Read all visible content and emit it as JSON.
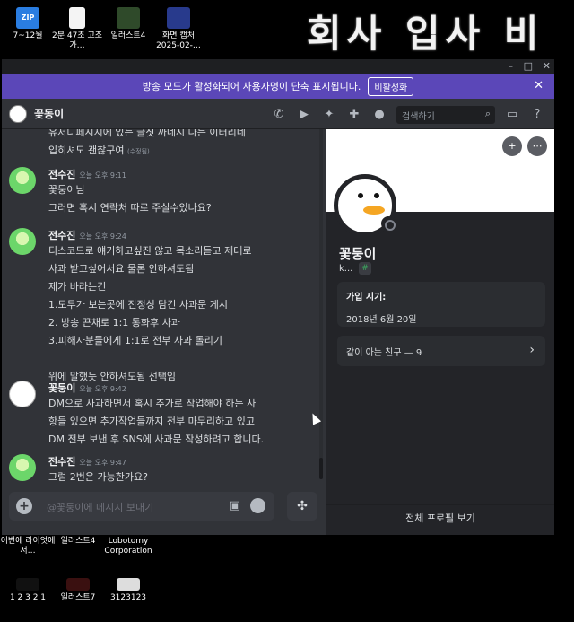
{
  "desktop": {
    "overlay_title": "회사 입사 비",
    "top_icons": [
      {
        "label": "7~12월",
        "icon": "zip-archive-icon"
      },
      {
        "label": "2분 47초 고조가…",
        "icon": "document-icon"
      },
      {
        "label": "일러스트4",
        "icon": "image-file-icon"
      },
      {
        "label": "화면 캡처 2025-02-…",
        "icon": "screenshot-icon"
      }
    ],
    "bottom_icons": [
      {
        "label": "이번에 라이엇에서…",
        "icon": "file-icon"
      },
      {
        "label": "일러스트4",
        "icon": "file-icon"
      },
      {
        "label": "Lobotomy Corporation",
        "icon": "game-icon"
      },
      {
        "label": "1 2 3 2 1",
        "icon": "image-file-icon"
      },
      {
        "label": "일러스트7",
        "icon": "image-file-icon"
      },
      {
        "label": "3123123",
        "icon": "image-file-icon"
      }
    ]
  },
  "window": {
    "controls": [
      "–",
      "□",
      "✕"
    ],
    "banner": {
      "text": "방송 모드가 활성화되어 사용자명이 단축 표시됩니다.",
      "button": "비활성화",
      "close": "✕"
    },
    "header": {
      "name": "꽃동이",
      "search_placeholder": "검색하기"
    }
  },
  "chat": {
    "partial_lines": [
      "유저디페시지에 있는 글짓 까네시 나는 이터리네",
      "입히셔도 괜찮구여"
    ],
    "partial_edited": "(수정됨)",
    "messages": [
      {
        "author": "전수진",
        "time": "오늘 오후 9:11",
        "avatar": "green",
        "lines": [
          "꽃둥이님",
          "그러면 혹시 연락처 따로 주실수있나요?"
        ]
      },
      {
        "author": "전수진",
        "time": "오늘 오후 9:24",
        "avatar": "green",
        "lines": [
          "디스코드로 얘기하고싶진 않고 목소리듣고 제대로",
          "사과 받고싶어서요 물론 안하셔도됨",
          "제가 바라는건",
          "1.모두가 보는곳에 진정성 담긴 사과문 게시",
          "2. 방송 끈채로 1:1 통화후 사과",
          "3.피해자분들에게 1:1로 전부 사과 돌리기",
          "",
          "위에 말했듯 안하셔도됨 선택임"
        ]
      },
      {
        "author": "꽃둥이",
        "time": "오늘 오후 9:42",
        "avatar": "duck",
        "lines": [
          "DM으로 사과하면서 혹시 추가로 작업해야 하는 사",
          "항들 있으면 추가작업들까지 전부 마무리하고 있고",
          "DM 전부 보낸 후 SNS에 사과문 작성하려고 합니다."
        ]
      },
      {
        "author": "전수진",
        "time": "오늘 오후 9:47",
        "avatar": "green",
        "lines": [
          "그럼 2번은 가능한가요?"
        ]
      }
    ],
    "composer_placeholder": "@꽃둥이에 메시지 보내기"
  },
  "profile": {
    "name": "꽃둥이",
    "tag": "k...",
    "member_since_label": "가입 시기:",
    "member_since_value": "2018년 6월 20일",
    "mutual_friends": "같이 아는 친구 — 9",
    "view_full": "전체 프로필 보기"
  }
}
